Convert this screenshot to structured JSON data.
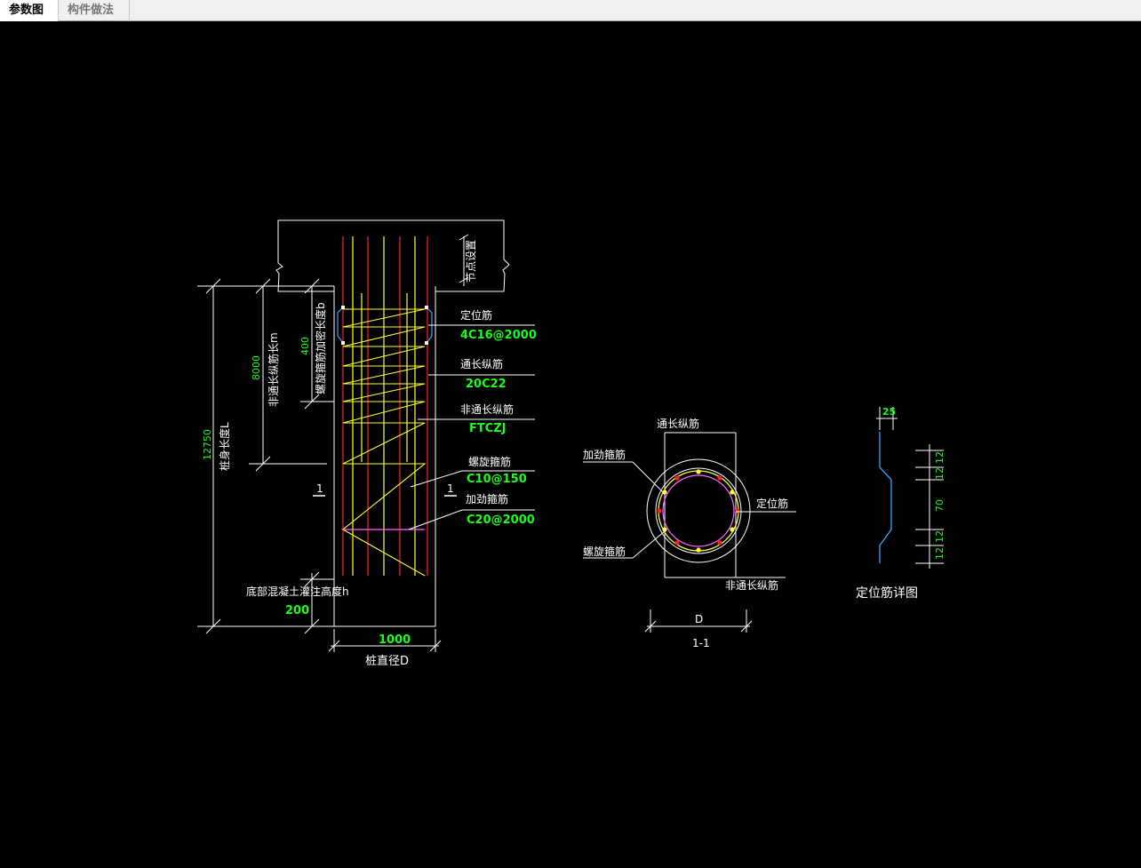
{
  "tabs": [
    {
      "label": "参数图",
      "active": true
    },
    {
      "label": "构件做法",
      "active": false
    }
  ],
  "colors": {
    "background": "#000000",
    "dimension_text": "#19ff19",
    "outline": "#ffffff",
    "rebar_main": "#ff2020",
    "rebar_secondary": "#ffff33",
    "stiffener": "#ff66ff",
    "locator_bar": "#33aaff"
  },
  "drawing": {
    "node_label": "节点设置",
    "pile_length_label": "桩身长度L",
    "pile_length_value": "12750",
    "non_through_len_label": "非通长纵筋长m",
    "non_through_len_value": "8000",
    "spiral_dense_label": "螺旋箍筋加密长度b",
    "spiral_dense_value": "400",
    "locator_bar_label": "定位筋",
    "locator_bar_value": "4C16@2000",
    "through_long_label": "通长纵筋",
    "through_long_value": "20C22",
    "non_through_long_label": "非通长纵筋",
    "non_through_long_value": "FTCZJ",
    "spiral_stirrup_label": "螺旋箍筋",
    "spiral_stirrup_value": "C10@150",
    "stiffening_stirrup_label": "加劲箍筋",
    "stiffening_stirrup_value": "C20@2000",
    "section_mark": "1",
    "bottom_concrete_label": "底部混凝土灌注高度h",
    "bottom_concrete_value": "200",
    "diameter_value": "1000",
    "diameter_label": "桩直径D",
    "section": {
      "through_long_label": "通长纵筋",
      "stiffening_label": "加劲箍筋",
      "locator_label": "定位筋",
      "spiral_label": "螺旋箍筋",
      "non_through_label": "非通长纵筋",
      "dim_label": "D",
      "title": "1-1"
    },
    "detail": {
      "dim_top": "25",
      "dim_a": "12",
      "dim_b": "12",
      "dim_mid": "70",
      "dim_c": "12",
      "dim_d": "12",
      "title": "定位筋详图"
    }
  }
}
